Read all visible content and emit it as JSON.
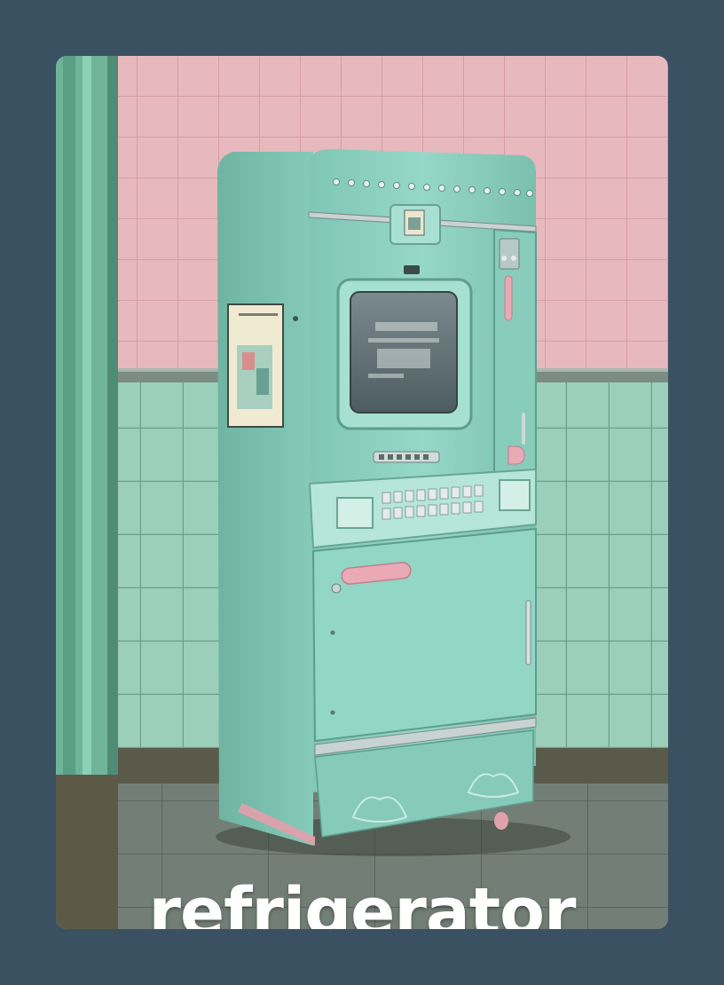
{
  "card": {
    "caption": "refrigerator",
    "background_color": "#3a5161",
    "fridge_color": "#8fd3c4",
    "wall_tile_pink": "#e7b9be",
    "wall_tile_green": "#95c9b4",
    "accent_pink": "#e9a9b5"
  }
}
